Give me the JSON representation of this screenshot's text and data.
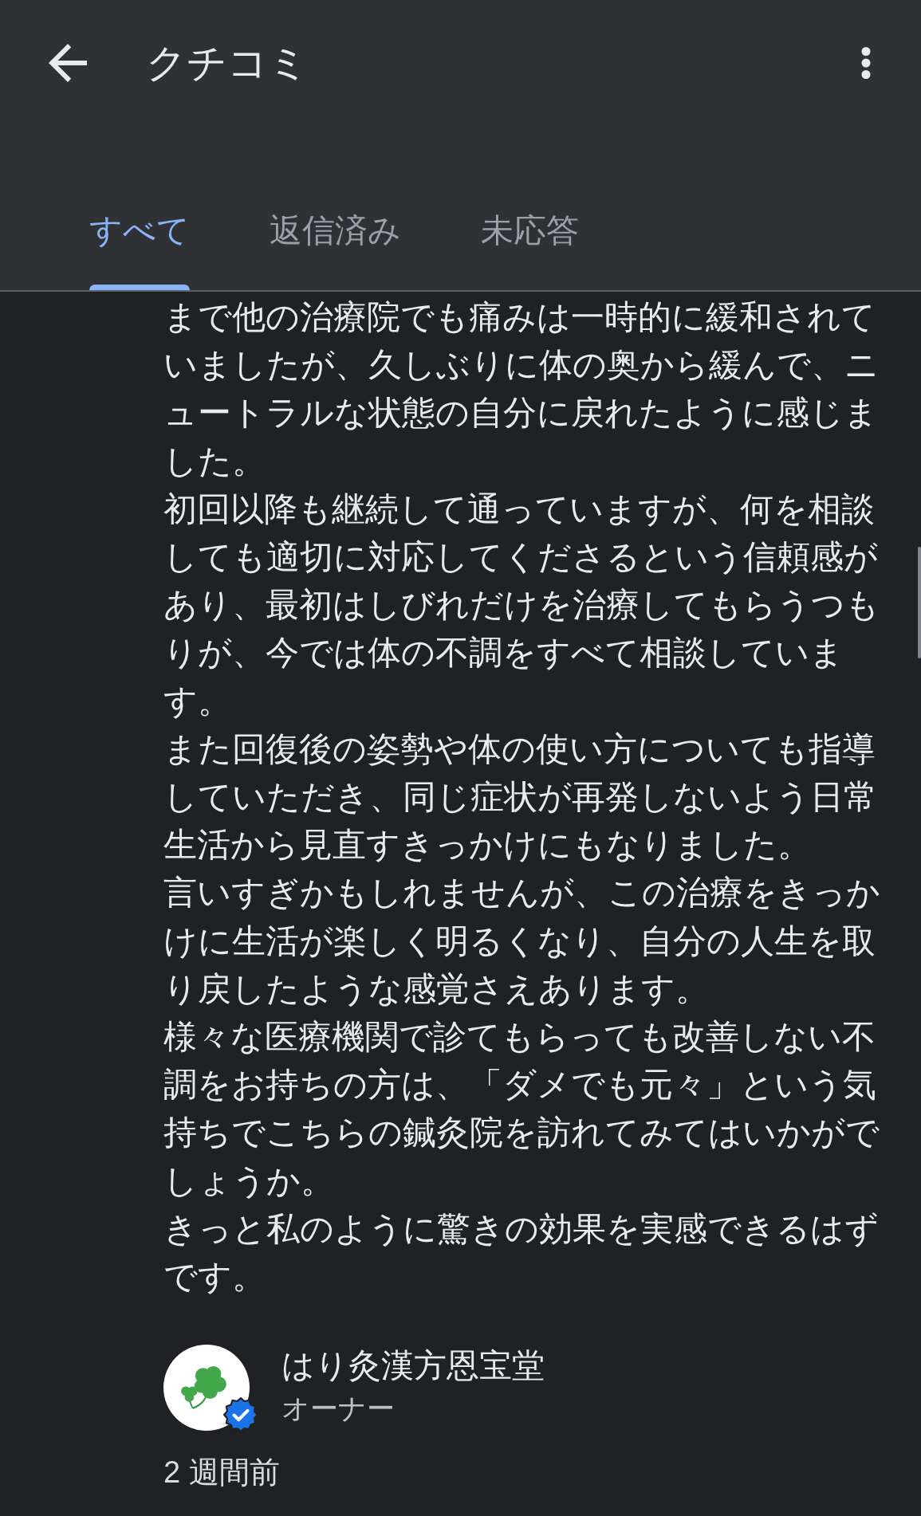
{
  "header": {
    "title": "クチコミ"
  },
  "tabs": [
    {
      "label": "すべて",
      "selected": true
    },
    {
      "label": "返信済み",
      "selected": false
    },
    {
      "label": "未応答",
      "selected": false
    }
  ],
  "review": {
    "paragraphs": [
      "まで他の治療院でも痛みは一時的に緩和されていましたが、久しぶりに体の奥から緩んで、ニュートラルな状態の自分に戻れたように感じました。",
      "初回以降も継続して通っていますが、何を相談しても適切に対応してくださるという信頼感があり、最初はしびれだけを治療してもらうつもりが、今では体の不調をすべて相談しています。",
      "また回復後の姿勢や体の使い方についても指導していただき、同じ症状が再発しないよう日常生活から見直すきっかけにもなりました。",
      "言いすぎかもしれませんが、この治療をきっかけに生活が楽しく明るくなり、自分の人生を取り戻したような感覚さえあります。",
      "様々な医療機関で診てもらっても改善しない不調をお持ちの方は、「ダメでも元々」という気持ちでこちらの鍼灸院を訪れてみてはいかがでしょうか。",
      "きっと私のように驚きの効果を実感できるはずです。"
    ]
  },
  "owner_reply": {
    "name": "はり灸漢方恩宝堂",
    "role": "オーナー",
    "verified": true,
    "time": "2 週間前"
  }
}
